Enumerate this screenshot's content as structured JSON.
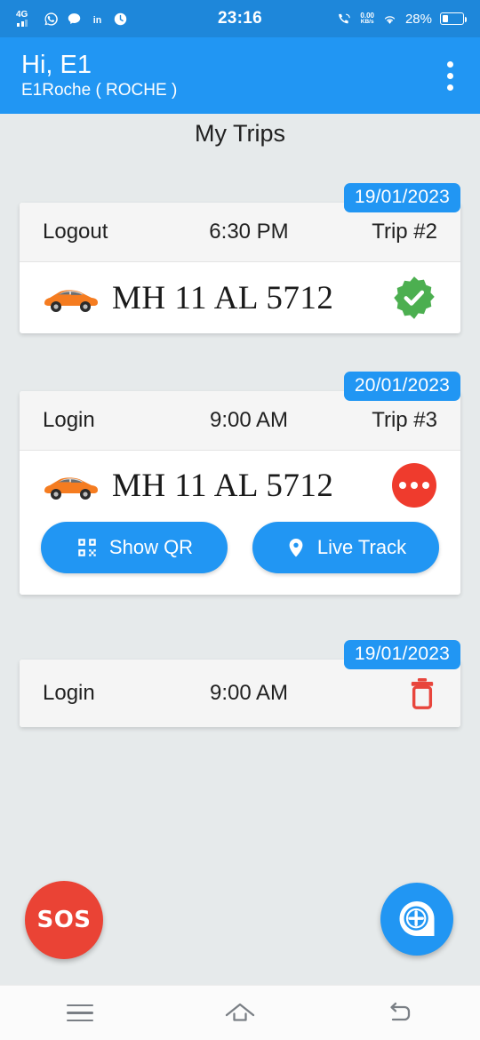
{
  "status_bar": {
    "network": "4G",
    "time": "23:16",
    "data_rate_value": "0.00",
    "data_rate_unit": "KB/s",
    "battery_percent": "28%",
    "left_icons": [
      "signal-4g-icon",
      "whatsapp-icon",
      "message-icon",
      "linkedin-icon",
      "clock-icon"
    ],
    "right_icons": [
      "call-wifi-icon",
      "wifi-icon",
      "battery-icon"
    ]
  },
  "app_bar": {
    "greeting": "Hi, E1",
    "subtitle": "E1Roche ( ROCHE )",
    "menu_icon": "kebab-menu-icon",
    "background": "#2196f3"
  },
  "page": {
    "title": "My Trips",
    "background": "#e6eaeb"
  },
  "trips": [
    {
      "date": "19/01/2023",
      "type": "Logout",
      "time": "6:30 PM",
      "trip_label": "Trip #2",
      "vehicle": "MH 11 AL 5712",
      "status": "verified",
      "status_color": "#4caf50",
      "has_vehicle_row": true,
      "actions": []
    },
    {
      "date": "20/01/2023",
      "type": "Login",
      "time": "9:00 AM",
      "trip_label": "Trip #3",
      "vehicle": "MH 11 AL 5712",
      "status": "pending",
      "status_color": "#ef3b2d",
      "has_vehicle_row": true,
      "actions": [
        {
          "label": "Show QR",
          "icon": "qr-code-icon"
        },
        {
          "label": "Live Track",
          "icon": "location-pin-icon"
        }
      ]
    },
    {
      "date": "19/01/2023",
      "type": "Login",
      "time": "9:00 AM",
      "trip_label": "",
      "vehicle": "",
      "status": "delete",
      "status_color": "#e53935",
      "has_vehicle_row": false,
      "actions": []
    }
  ],
  "fabs": {
    "sos_label": "SOS",
    "sos_color": "#ea4335",
    "add_icon": "add-location-icon",
    "add_color": "#2196f3"
  },
  "nav_bar": {
    "recents_icon": "recents-menu-icon",
    "home_icon": "home-icon",
    "back_icon": "back-arrow-icon"
  }
}
